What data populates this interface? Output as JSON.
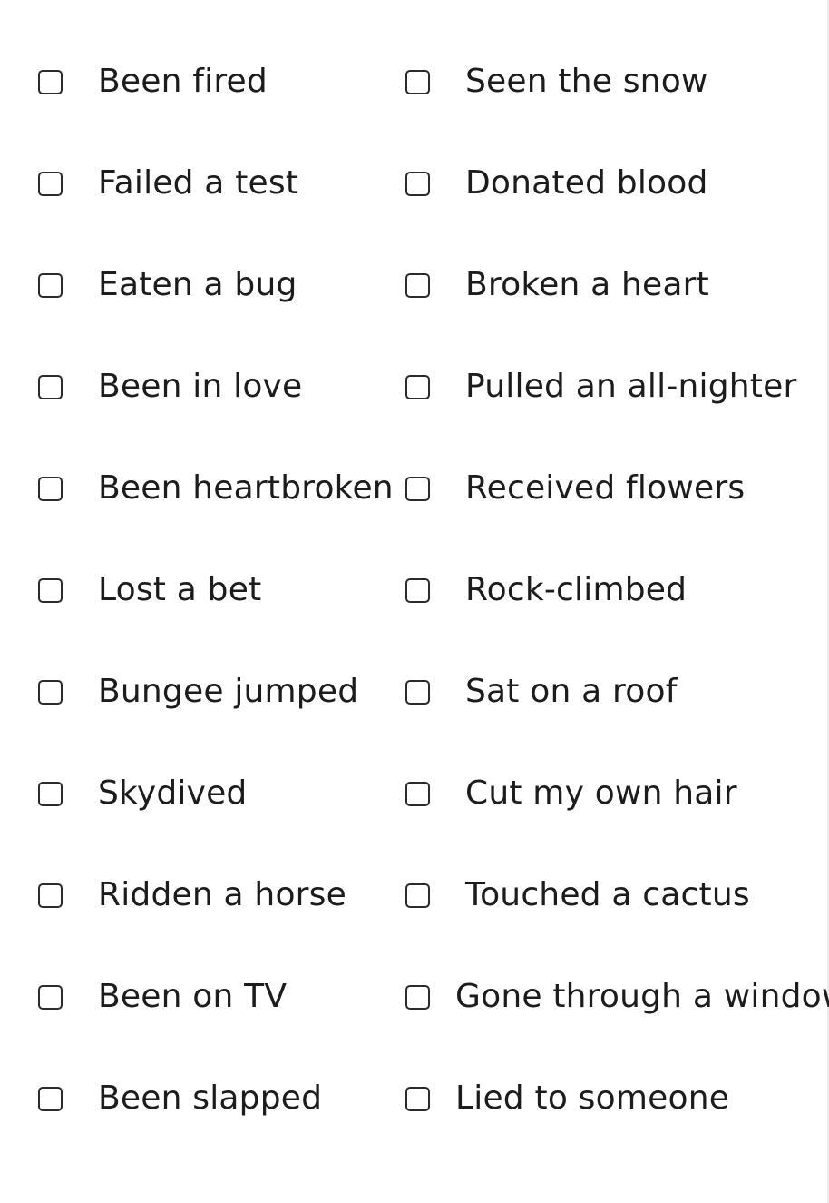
{
  "checklist": {
    "left": [
      {
        "label": "Been fired",
        "checked": false
      },
      {
        "label": "Failed a test",
        "checked": false
      },
      {
        "label": "Eaten a bug",
        "checked": false
      },
      {
        "label": "Been in love",
        "checked": false
      },
      {
        "label": "Been heartbroken",
        "checked": false
      },
      {
        "label": "Lost a bet",
        "checked": false
      },
      {
        "label": "Bungee jumped",
        "checked": false
      },
      {
        "label": "Skydived",
        "checked": false
      },
      {
        "label": "Ridden a horse",
        "checked": false
      },
      {
        "label": "Been on TV",
        "checked": false
      },
      {
        "label": "Been slapped",
        "checked": false
      }
    ],
    "right": [
      {
        "label": "Seen the snow",
        "checked": false
      },
      {
        "label": "Donated blood",
        "checked": false
      },
      {
        "label": "Broken a heart",
        "checked": false
      },
      {
        "label": "Pulled an all-nighter",
        "checked": false
      },
      {
        "label": "Received flowers",
        "checked": false
      },
      {
        "label": "Rock-climbed",
        "checked": false
      },
      {
        "label": "Sat on a roof",
        "checked": false
      },
      {
        "label": "Cut my own hair",
        "checked": false
      },
      {
        "label": "Touched a cactus",
        "checked": false
      },
      {
        "label": "Gone through a window",
        "checked": false
      },
      {
        "label": "Lied to someone",
        "checked": false
      }
    ]
  }
}
